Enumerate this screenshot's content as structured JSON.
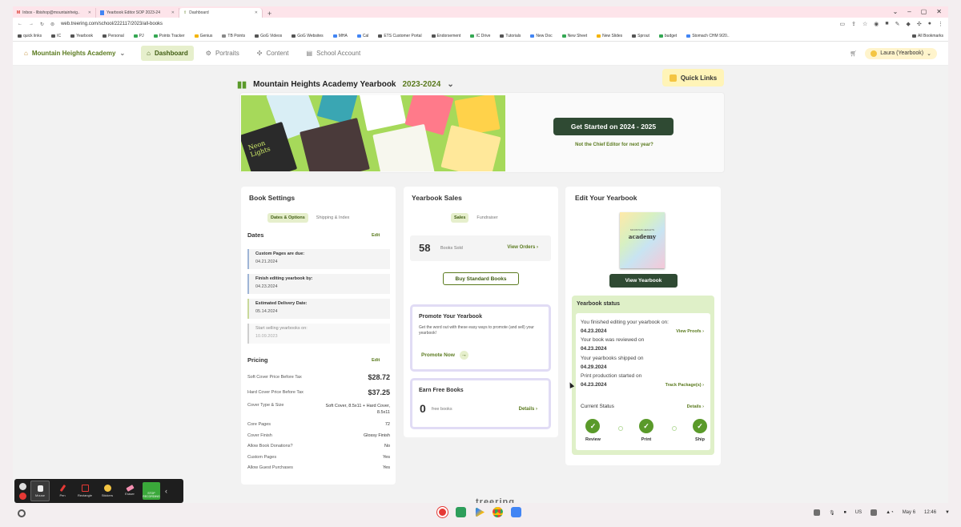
{
  "browser": {
    "tabs": [
      {
        "label": "Inbox - llbishop@mountainheig..",
        "icon_color": "#d93025"
      },
      {
        "label": "Yearbook Editor SOP 2023-24",
        "icon_color": "#4285f4"
      },
      {
        "label": "Dashboard",
        "icon_color": "#5a7a1e"
      }
    ],
    "url": "web.treering.com/school/222117/2023/all-books",
    "bookmarks": [
      "quick links",
      "IC",
      "Yearbook",
      "Personal",
      "PJ",
      "Points Tracker",
      "Genius",
      "TB Points",
      "GoG Videos",
      "GoG Websites",
      "MHA",
      "Cal",
      "ETS Customer Portal",
      "Endorsement",
      "IC Drive",
      "Tutorials",
      "New Doc",
      "New Sheet",
      "New Slides",
      "Sprout",
      "budget",
      "Stomach CHM 9/20.."
    ],
    "all_bookmarks": "All Bookmarks"
  },
  "nav": {
    "school": "Mountain Heights Academy",
    "items": [
      "Dashboard",
      "Portraits",
      "Content",
      "School Account"
    ],
    "user": "Laura (Yearbook)"
  },
  "yearbook": {
    "title": "Mountain Heights Academy Yearbook",
    "year": "2023-2024",
    "quick_links": "Quick Links",
    "get_started": "Get Started on 2024 - 2025",
    "not_chief": "Not the Chief Editor for next year?",
    "hero_book_text": [
      "Neon Lights"
    ]
  },
  "book_settings": {
    "title": "Book Settings",
    "tabs": [
      "Dates & Options",
      "Shipping & Index"
    ],
    "dates_label": "Dates",
    "edit": "Edit",
    "dates": [
      {
        "label": "Custom Pages are due:",
        "value": "04.21.2024",
        "color": "#9fb5d6"
      },
      {
        "label": "Finish editing yearbook by:",
        "value": "04.23.2024",
        "color": "#9fb5d6"
      },
      {
        "label": "Estimated Delivery Date:",
        "value": "05.14.2024",
        "color": "#c9d99a"
      },
      {
        "label": "Start selling yearbooks on:",
        "value": "10.09.2023",
        "color": "#cfcfcf"
      }
    ],
    "pricing_label": "Pricing",
    "pricing": [
      {
        "label": "Soft Cover Price Before Tax",
        "value": "$28.72"
      },
      {
        "label": "Hard Cover Price Before Tax",
        "value": "$37.25"
      },
      {
        "label": "Cover Type & Size",
        "value": "Soft Cover, 8.5x11 + Hard Cover, 8.5x11"
      },
      {
        "label": "Core Pages",
        "value": "72"
      },
      {
        "label": "Cover Finish",
        "value": "Glossy Finish"
      },
      {
        "label": "Allow Book Donations?",
        "value": "No"
      },
      {
        "label": "Custom Pages",
        "value": "Yes"
      },
      {
        "label": "Allow Guest Purchases",
        "value": "Yes"
      }
    ]
  },
  "sales": {
    "title": "Yearbook Sales",
    "tabs": [
      "Sales",
      "Fundraiser"
    ],
    "sold_count": "58",
    "sold_label": "Books Sold",
    "view_orders": "View Orders",
    "buy_standard": "Buy Standard Books",
    "promote_title": "Promote Your Yearbook",
    "promote_desc": "Get the word out with these easy ways to promote (and sell) your yearbook!",
    "promote_now": "Promote Now",
    "free_title": "Earn Free Books",
    "free_count": "0",
    "free_label": "free books",
    "details": "Details"
  },
  "edit_yearbook": {
    "title": "Edit Your Yearbook",
    "cover_small": "MOUNTAIN HEIGHTS",
    "cover_title": "academy",
    "view_yearbook": "View Yearbook",
    "status_title": "Yearbook status",
    "lines": [
      {
        "text": "You finished editing your yearbook on:",
        "date": "04.23.2024",
        "link": "View Proofs"
      },
      {
        "text": "Your book was reviewed on",
        "date": "04.23.2024",
        "link": ""
      },
      {
        "text": "Your yearbooks shipped on",
        "date": "04.29.2024",
        "link": ""
      },
      {
        "text": "Print production started on",
        "date": "04.23.2024",
        "link": "Track Package(s)"
      }
    ],
    "current_status": "Current Status",
    "status_details": "Details",
    "steps": [
      "Review",
      "Print",
      "Ship"
    ]
  },
  "footer_logo": "treering",
  "annotation_toolbar": [
    "Mouse",
    "Pen",
    "Rectangle",
    "Stickers",
    "Eraser"
  ],
  "stop_recording": "STOP RECORDING",
  "tray": {
    "locale": "US",
    "date": "May 6",
    "time": "12:46"
  },
  "colors": {
    "accent": "#5a7a1e",
    "dark_button": "#2f4a33",
    "highlight": "#e6efcc"
  }
}
